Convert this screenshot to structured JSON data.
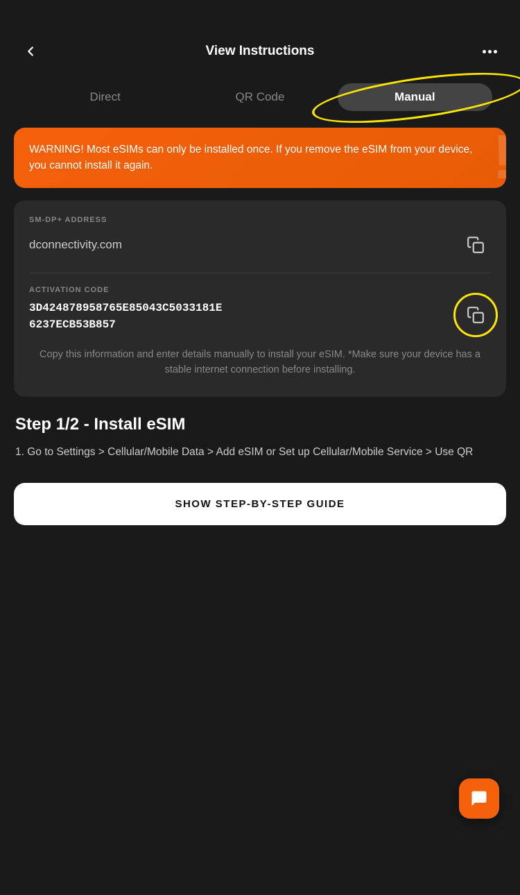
{
  "header": {
    "title": "View Instructions",
    "back_label": "back",
    "more_label": "more options"
  },
  "tabs": {
    "items": [
      {
        "id": "direct",
        "label": "Direct",
        "active": false
      },
      {
        "id": "qr-code",
        "label": "QR Code",
        "active": false
      },
      {
        "id": "manual",
        "label": "Manual",
        "active": true
      }
    ]
  },
  "warning": {
    "text": "WARNING! Most eSIMs can only be installed once. If you remove the eSIM from your device, you cannot install it again.",
    "icon": "!"
  },
  "smdp": {
    "label": "SM-DP+ ADDRESS",
    "value": "dconnectivity.com",
    "copy_label": "copy"
  },
  "activation": {
    "label": "ACTIVATION CODE",
    "value": "3D424878958765E85043C5033181E6237ECB53B857",
    "display": "3D424878958765E85043C5033181E\n6237ECB53B857",
    "copy_label": "copy activation code"
  },
  "info_note": "Copy this information and enter details manually to install your eSIM. *Make sure your device has a stable internet connection before installing.",
  "step": {
    "title": "Step 1/2 - Install eSIM",
    "text": "1. Go to Settings > Cellular/Mobile Data > Add eSIM or Set up Cellular/Mobile Service > Use QR"
  },
  "guide_button": {
    "label": "SHOW STEP-BY-STEP GUIDE"
  },
  "chat_button": {
    "label": "chat support"
  }
}
